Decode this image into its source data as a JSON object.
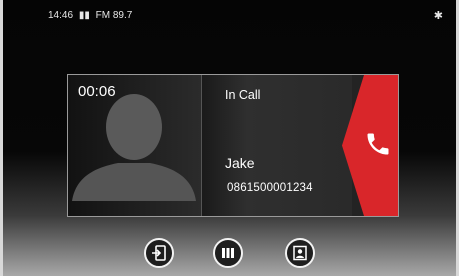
{
  "status_bar": {
    "time": "14:46",
    "signal_icon": "signal-bars-icon",
    "radio": "FM 89.7",
    "bluetooth_icon": "bluetooth-icon"
  },
  "call": {
    "timer": "00:06",
    "state": "In Call",
    "caller_name": "Jake",
    "caller_number": "0861500001234",
    "avatar_icon": "person-silhouette-icon",
    "hangup_icon": "phone-hangup-icon",
    "hangup_color": "#d9262a"
  },
  "toolbar": {
    "buttons": [
      {
        "icon": "transfer-to-phone-icon"
      },
      {
        "icon": "keypad-icon"
      },
      {
        "icon": "contacts-icon"
      }
    ]
  }
}
